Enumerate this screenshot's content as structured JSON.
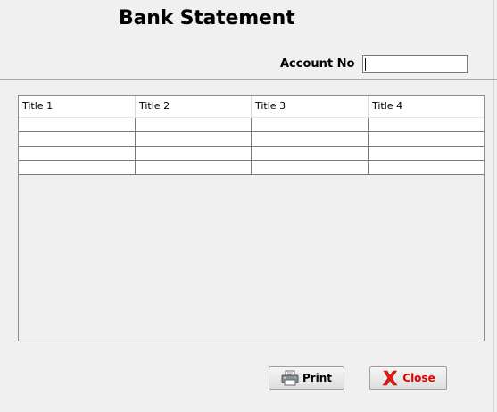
{
  "window": {
    "title": "Bank Statement"
  },
  "account": {
    "label": "Account No",
    "value": ""
  },
  "table": {
    "columns": [
      "Title 1",
      "Title 2",
      "Title 3",
      "Title 4"
    ],
    "rows": [
      [
        "",
        "",
        "",
        ""
      ],
      [
        "",
        "",
        "",
        ""
      ],
      [
        "",
        "",
        "",
        ""
      ],
      [
        "",
        "",
        "",
        ""
      ]
    ]
  },
  "buttons": {
    "print": {
      "label": "Print",
      "icon": "printer-icon"
    },
    "close": {
      "label": "Close",
      "icon": "close-x-icon",
      "color": "#e60000"
    }
  }
}
